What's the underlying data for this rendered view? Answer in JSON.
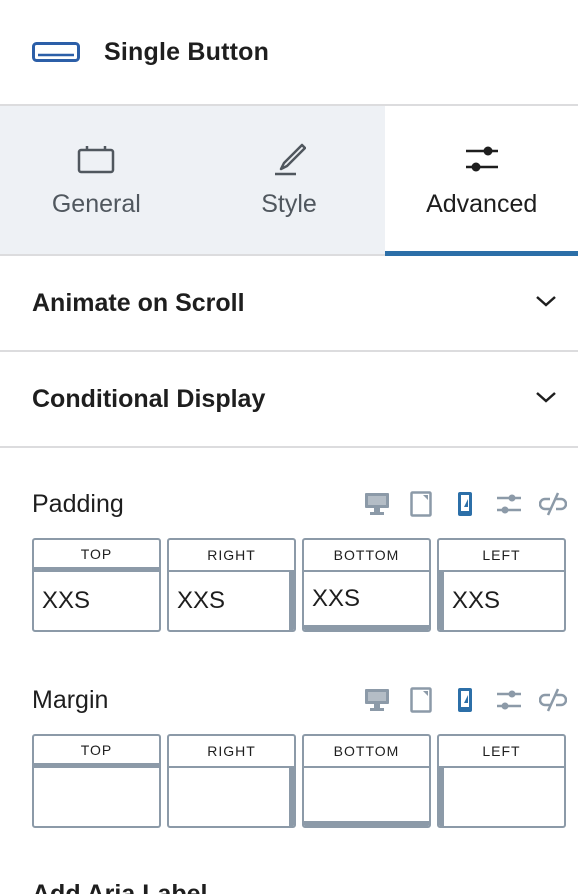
{
  "header": {
    "title": "Single Button",
    "icon": "button-block-icon"
  },
  "tabs": [
    {
      "label": "General",
      "icon": "general-icon",
      "active": false
    },
    {
      "label": "Style",
      "icon": "brush-icon",
      "active": false
    },
    {
      "label": "Advanced",
      "icon": "sliders-icon",
      "active": true
    }
  ],
  "panels": [
    {
      "title": "Animate on Scroll"
    },
    {
      "title": "Conditional Display"
    }
  ],
  "padding": {
    "label": "Padding",
    "fields": [
      {
        "label": "TOP",
        "value": "XXS"
      },
      {
        "label": "RIGHT",
        "value": "XXS"
      },
      {
        "label": "BOTTOM",
        "value": "XXS"
      },
      {
        "label": "LEFT",
        "value": "XXS"
      }
    ]
  },
  "margin": {
    "label": "Margin",
    "fields": [
      {
        "label": "TOP",
        "value": ""
      },
      {
        "label": "RIGHT",
        "value": ""
      },
      {
        "label": "BOTTOM",
        "value": ""
      },
      {
        "label": "LEFT",
        "value": ""
      }
    ]
  },
  "next_section": {
    "label": "Add Aria Label"
  },
  "colors": {
    "accent": "#2c6fa8",
    "active_device": "#2c6fa8",
    "muted_icon": "#8c9aa8"
  }
}
